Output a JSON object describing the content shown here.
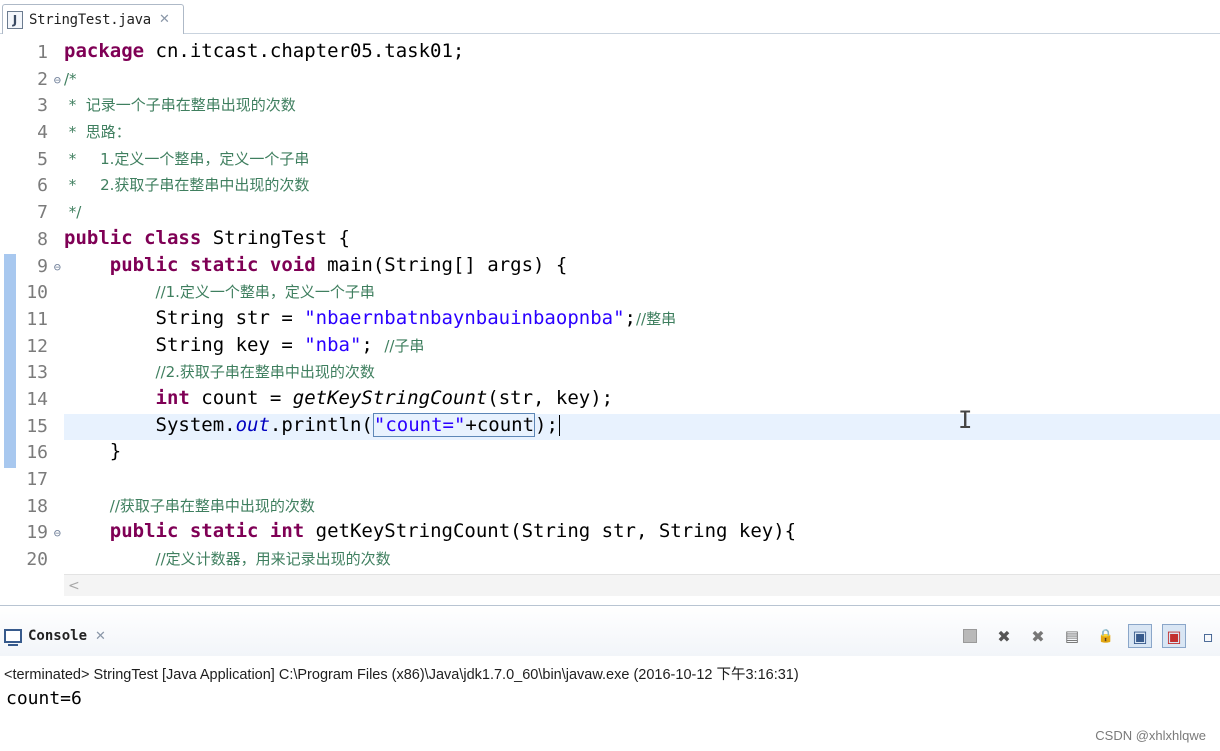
{
  "editor_tab": {
    "icon": "J",
    "filename": "StringTest.java",
    "close_glyph": "✕"
  },
  "code_lines": [
    {
      "num": "1",
      "fold": ""
    },
    {
      "num": "2",
      "fold": "⊖"
    },
    {
      "num": "3",
      "fold": ""
    },
    {
      "num": "4",
      "fold": ""
    },
    {
      "num": "5",
      "fold": ""
    },
    {
      "num": "6",
      "fold": ""
    },
    {
      "num": "7",
      "fold": ""
    },
    {
      "num": "8",
      "fold": ""
    },
    {
      "num": "9",
      "fold": "⊖"
    },
    {
      "num": "10",
      "fold": ""
    },
    {
      "num": "11",
      "fold": ""
    },
    {
      "num": "12",
      "fold": ""
    },
    {
      "num": "13",
      "fold": ""
    },
    {
      "num": "14",
      "fold": ""
    },
    {
      "num": "15",
      "fold": ""
    },
    {
      "num": "16",
      "fold": ""
    },
    {
      "num": "17",
      "fold": ""
    },
    {
      "num": "18",
      "fold": ""
    },
    {
      "num": "19",
      "fold": "⊖"
    },
    {
      "num": "20",
      "fold": ""
    }
  ],
  "code": {
    "l1": {
      "kw": "package",
      "rest": " cn.itcast.chapter05.task01;"
    },
    "l2": {
      "comment": "/*"
    },
    "l3": {
      "comment": " *  记录一个子串在整串出现的次数"
    },
    "l4": {
      "comment": " *  思路："
    },
    "l5": {
      "comment": " *     1.定义一个整串，定义一个子串"
    },
    "l6": {
      "comment": " *     2.获取子串在整串中出现的次数"
    },
    "l7": {
      "comment": " */"
    },
    "l8": {
      "kw": "public class",
      "rest": " StringTest {"
    },
    "l9": {
      "indent": "    ",
      "kw": "public static void",
      "rest": " main(String[] args) {"
    },
    "l10": {
      "indent": "        ",
      "comment": "//1.定义一个整串，定义一个子串"
    },
    "l11": {
      "pre": "        String str = ",
      "str": "\"nbaernbatnbaynbauinbaopnba\"",
      "post": ";",
      "comment": "//整串"
    },
    "l12": {
      "pre": "        String key = ",
      "str": "\"nba\"",
      "post": "; ",
      "comment": "//子串"
    },
    "l13": {
      "indent": "        ",
      "comment": "//2.获取子串在整串中出现的次数"
    },
    "l14": {
      "indent": "        ",
      "kw": "int",
      "mid": " count = ",
      "method": "getKeyStringCount",
      "post": "(str, key);"
    },
    "l15": {
      "pre": "        System.",
      "field": "out",
      "mid": ".println(",
      "str": "\"count=\"",
      "post": "+count",
      "end": ");"
    },
    "l16": {
      "text": "    }"
    },
    "l17": {
      "text": ""
    },
    "l18": {
      "indent": "    ",
      "comment": "//获取子串在整串中出现的次数"
    },
    "l19": {
      "indent": "    ",
      "kw": "public static int",
      "rest": " getKeyStringCount(String str, String key){"
    },
    "l20": {
      "indent": "        ",
      "comment": "//定义计数器，用来记录出现的次数"
    }
  },
  "hscroll_arrow": "<",
  "console": {
    "tab_label": "Console",
    "close_glyph": "✕",
    "toolbar": [
      {
        "name": "terminate-icon",
        "glyph": ""
      },
      {
        "name": "remove-launch-icon",
        "glyph": "✖"
      },
      {
        "name": "remove-all-terminated-icon",
        "glyph": "✖"
      },
      {
        "name": "clear-console-icon",
        "glyph": "▤"
      },
      {
        "name": "scroll-lock-icon",
        "glyph": "🔒"
      },
      {
        "name": "pin-console-icon",
        "glyph": "▣"
      },
      {
        "name": "display-selected-console-icon",
        "glyph": "▣"
      },
      {
        "name": "open-console-icon",
        "glyph": "▫"
      }
    ],
    "status": "<terminated> StringTest [Java Application] C:\\Program Files (x86)\\Java\\jdk1.7.0_60\\bin\\javaw.exe (2016-10-12 下午3:16:31)",
    "output": "count=6"
  },
  "watermark": "CSDN @xhlxhlqwe",
  "colors": {
    "keyword": "#7f0055",
    "comment": "#3f7f5f",
    "string": "#2a00ff",
    "field": "#0000c0",
    "current_line": "#e8f2fe",
    "change_bar": "#a8c8ef"
  }
}
